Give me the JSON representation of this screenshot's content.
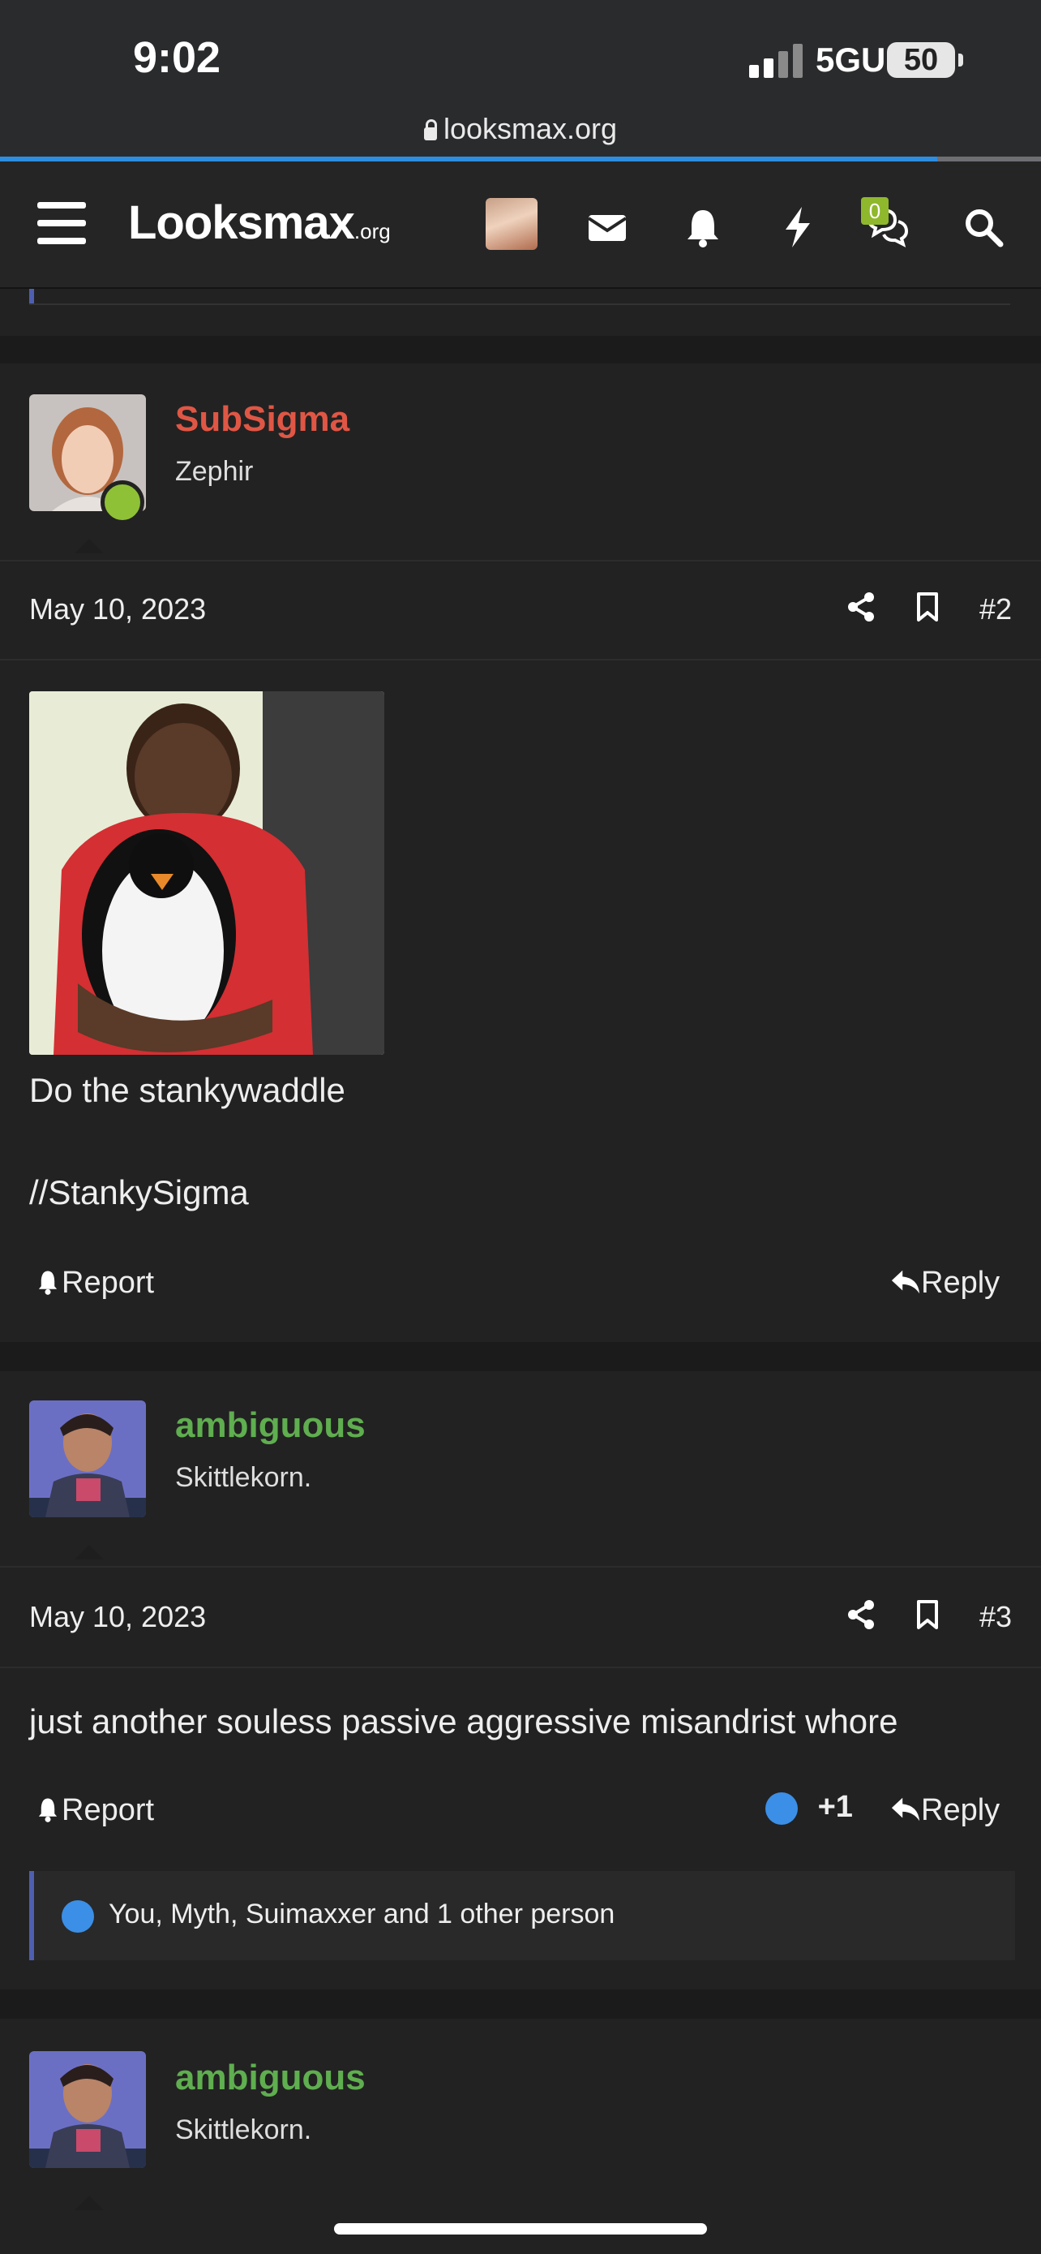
{
  "status_bar": {
    "time": "9:02",
    "network": "5GUC",
    "battery": "50"
  },
  "browser": {
    "url": "looksmax.org",
    "load_progress": 0.9
  },
  "header": {
    "logo_main": "Looksmax",
    "logo_suffix": ".org",
    "convo_badge": "0"
  },
  "posts": [
    {
      "username": "SubSigma",
      "username_color": "#e05645",
      "user_title": "Zephir",
      "online": true,
      "date": "May 10, 2023",
      "number": "#2",
      "lines": [
        "Do the stankywaddle",
        "//StankySigma"
      ],
      "report_label": "Report",
      "reply_label": "Reply"
    },
    {
      "username": "ambiguous",
      "username_color": "#5fae4f",
      "user_title": "Skittlekorn.",
      "date": "May 10, 2023",
      "number": "#3",
      "message": "just another souless passive aggressive misandrist whore",
      "report_label": "Report",
      "reaction_score": "+1",
      "reply_label": "Reply",
      "reaction_text": "You, Myth, Suimaxxer and 1 other person"
    },
    {
      "username": "ambiguous",
      "username_color": "#5fae4f",
      "user_title": "Skittlekorn."
    }
  ]
}
